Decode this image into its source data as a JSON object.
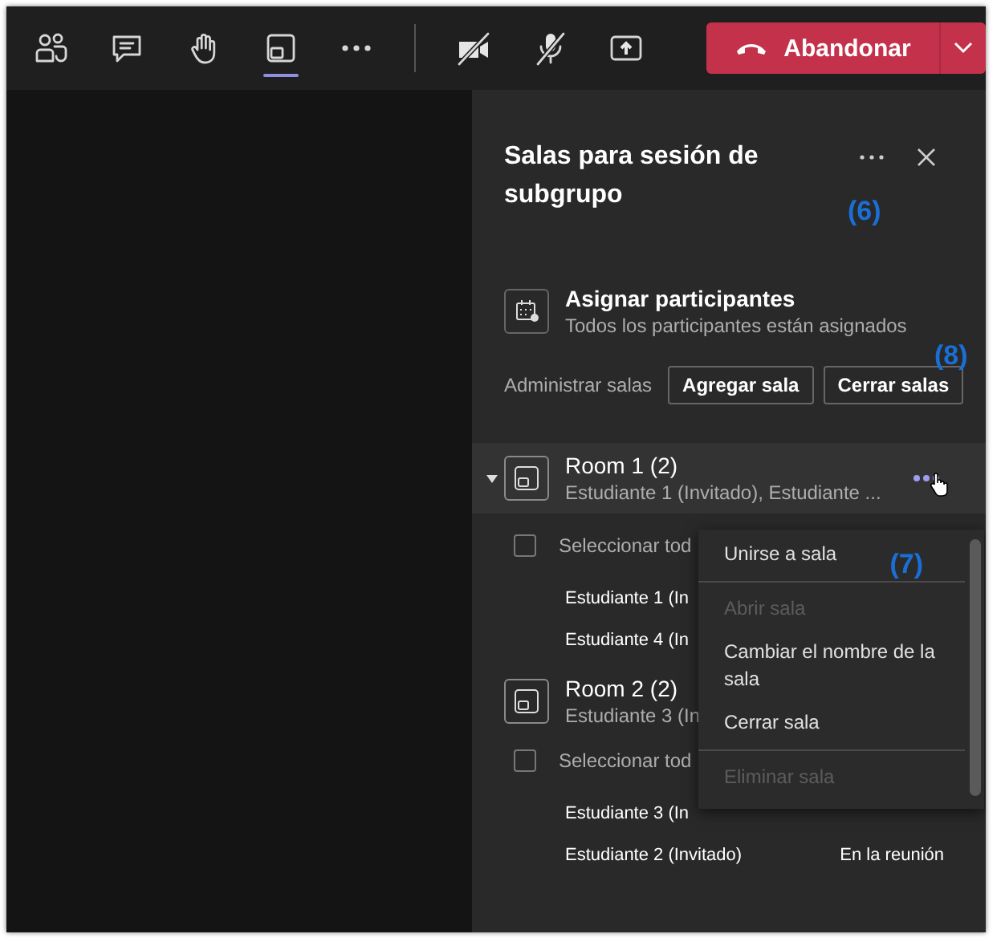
{
  "toolbar": {
    "buttons": [
      {
        "kind": "people",
        "selected": false
      },
      {
        "kind": "chat",
        "selected": false
      },
      {
        "kind": "hand",
        "selected": false
      },
      {
        "kind": "rooms",
        "selected": true
      },
      {
        "kind": "more",
        "selected": false
      }
    ],
    "media": [
      {
        "kind": "camera-off"
      },
      {
        "kind": "mic-off"
      },
      {
        "kind": "share"
      }
    ],
    "leave_button": {
      "label": "Abandonar"
    }
  },
  "panel": {
    "title": "Salas para sesión de subgrupo",
    "callout": "(6)",
    "assign": {
      "title": "Asignar participantes",
      "subtitle": "Todos los participantes están asignados",
      "callout": "(8)"
    },
    "manage": {
      "label": "Administrar salas",
      "buttons": [
        "Agregar sala",
        "Cerrar salas"
      ]
    },
    "rooms": [
      {
        "name": "Room 1 (2)",
        "members": "Estudiante 1 (Invitado), Estudiante ...",
        "selected": true,
        "select_all": {
          "label": "Seleccionar tod",
          "checked": false
        },
        "participants": [
          {
            "name": "Estudiante 1 (In"
          },
          {
            "name": "Estudiante 4 (In"
          }
        ]
      },
      {
        "name": "Room 2 (2)",
        "members": "Estudiante 3 (In",
        "selected": false,
        "select_all": {
          "label": "Seleccionar tod",
          "checked": false
        },
        "participants": [
          {
            "name": "Estudiante 3 (In"
          },
          {
            "name": "Estudiante 2 (Invitado)",
            "status": "En la reunión"
          }
        ]
      }
    ],
    "menu": {
      "callout": "(7)",
      "items": [
        {
          "label": "Unirse a sala",
          "disabled": false,
          "divider_after": true
        },
        {
          "label": "Abrir sala",
          "disabled": true,
          "divider_after": false
        },
        {
          "label": "Cambiar el nombre de la sala",
          "disabled": false,
          "divider_after": false
        },
        {
          "label": "Cerrar sala",
          "disabled": false,
          "divider_after": true
        },
        {
          "label": "Eliminar sala",
          "disabled": true,
          "divider_after": false
        }
      ]
    }
  }
}
